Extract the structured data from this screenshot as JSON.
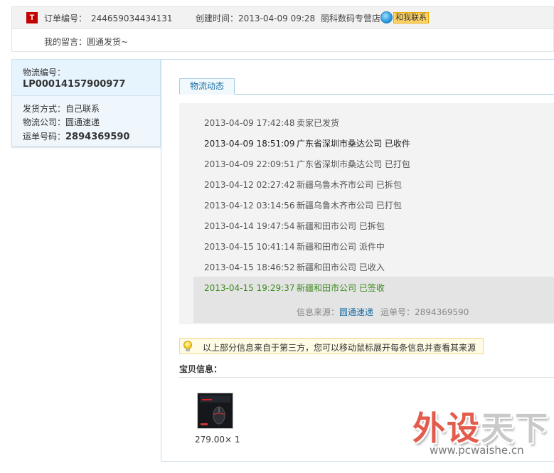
{
  "order": {
    "logo_letter": "T",
    "number_label": "订单编号：",
    "number": "244659034434131",
    "created_label": "创建时间：",
    "created": "2013-04-09 09:28",
    "shop": "丽科数码专营店",
    "contact": "和我联系",
    "message_label": "我的留言：",
    "message": "圆通发货~"
  },
  "logistics": {
    "id_label": "物流编号：",
    "id": "LP00014157900977",
    "method_label": "发货方式：",
    "method": "自己联系",
    "company_label": "物流公司：",
    "company": "圆通速递",
    "waybill_label": "运单号码：",
    "waybill": "2894369590"
  },
  "tab_label": "物流动态",
  "tracking": [
    {
      "time": "2013-04-09 17:42:48",
      "event": "卖家已发货"
    },
    {
      "time": "2013-04-09 18:51:09",
      "event": "广东省深圳市桑达公司 已收件"
    },
    {
      "time": "2013-04-09 22:09:51",
      "event": "广东省深圳市桑达公司 已打包"
    },
    {
      "time": "2013-04-12 02:27:42",
      "event": "新疆乌鲁木齐市公司 已拆包"
    },
    {
      "time": "2013-04-12 03:14:56",
      "event": "新疆乌鲁木齐市公司 已打包"
    },
    {
      "time": "2013-04-14 19:47:54",
      "event": "新疆和田市公司 已拆包"
    },
    {
      "time": "2013-04-15 10:41:14",
      "event": "新疆和田市公司 派件中"
    },
    {
      "time": "2013-04-15 18:46:52",
      "event": "新疆和田市公司 已收入"
    },
    {
      "time": "2013-04-15 19:29:37",
      "event": "新疆和田市公司 已签收"
    }
  ],
  "source": {
    "label": "信息来源：",
    "name": "圆通速递",
    "waybill_label": "运单号：",
    "waybill": "2894369590"
  },
  "notice": "以上部分信息来自于第三方，您可以移动鼠标展开每条信息并查看其来源",
  "goods": {
    "title": "宝贝信息：",
    "price": "279.00× 1"
  },
  "watermark": {
    "part1": "外设",
    "part2": "天下",
    "url": "www.pcwaishe.cn"
  },
  "colors": {
    "link": "#1a6fa5",
    "signed_green": "#3a8a1c",
    "tmall_red": "#c40000"
  }
}
